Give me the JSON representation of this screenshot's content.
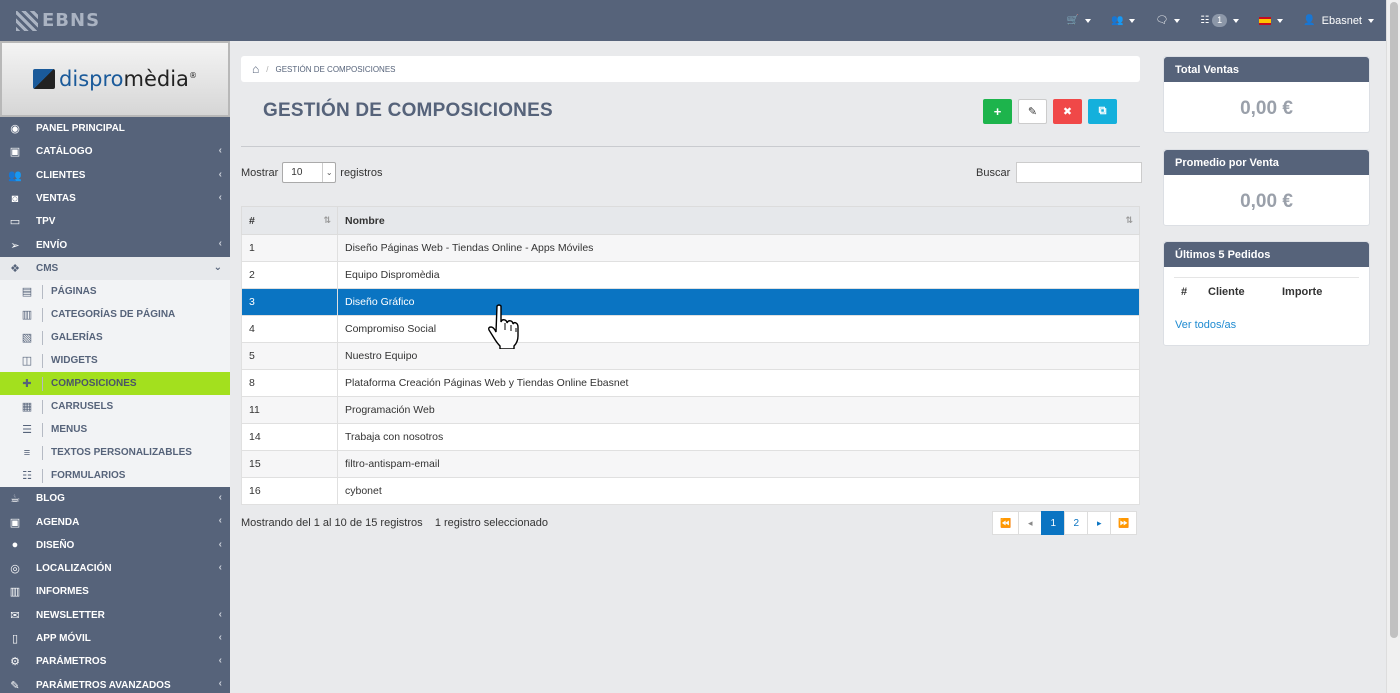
{
  "topbar": {
    "logo_text": "EBNS",
    "nav": [
      {
        "icon": "cart-icon",
        "glyph": "🛒"
      },
      {
        "icon": "users-icon",
        "glyph": "👥"
      },
      {
        "icon": "comments-icon",
        "glyph": "🗨"
      },
      {
        "icon": "list-icon",
        "glyph": "☷",
        "badge": "1"
      },
      {
        "icon": "flag-es-icon"
      },
      {
        "icon": "user-icon",
        "glyph": "👤",
        "label": "Ebasnet"
      }
    ]
  },
  "brand": {
    "name_a": "dispro",
    "name_b": "mèdia",
    "reg": "®"
  },
  "sidebar": {
    "items": [
      {
        "label": "PANEL PRINCIPAL",
        "icon": "dashboard-icon",
        "glyph": "◉",
        "arrow": ""
      },
      {
        "label": "CATÁLOGO",
        "icon": "box-icon",
        "glyph": "▣",
        "arrow": "‹"
      },
      {
        "label": "CLIENTES",
        "icon": "users-icon",
        "glyph": "👥",
        "arrow": "‹"
      },
      {
        "label": "VENTAS",
        "icon": "money-icon",
        "glyph": "◙",
        "arrow": "‹"
      },
      {
        "label": "TPV",
        "icon": "credit-card-icon",
        "glyph": "▭",
        "arrow": ""
      },
      {
        "label": "ENVÍO",
        "icon": "paper-plane-icon",
        "glyph": "➢",
        "arrow": "‹"
      },
      {
        "label": "CMS",
        "icon": "cubes-icon",
        "glyph": "❖",
        "arrow": "⌄"
      }
    ],
    "sub_items": [
      {
        "label": "PÁGINAS",
        "icon": "file-icon",
        "glyph": "▤"
      },
      {
        "label": "CATEGORÍAS DE PÁGINA",
        "icon": "files-icon",
        "glyph": "▥"
      },
      {
        "label": "GALERÍAS",
        "icon": "image-icon",
        "glyph": "▧"
      },
      {
        "label": "WIDGETS",
        "icon": "columns-icon",
        "glyph": "◫"
      },
      {
        "label": "COMPOSICIONES",
        "icon": "puzzle-icon",
        "glyph": "✚"
      },
      {
        "label": "CARRUSELS",
        "icon": "carousel-icon",
        "glyph": "▦"
      },
      {
        "label": "MENUS",
        "icon": "menu-icon",
        "glyph": "☰"
      },
      {
        "label": "TEXTOS PERSONALIZABLES",
        "icon": "align-left-icon",
        "glyph": "≡"
      },
      {
        "label": "FORMULARIOS",
        "icon": "form-list-icon",
        "glyph": "☷"
      }
    ],
    "items_after": [
      {
        "label": "BLOG",
        "icon": "coffee-icon",
        "glyph": "☕",
        "arrow": "‹"
      },
      {
        "label": "AGENDA",
        "icon": "calendar-icon",
        "glyph": "▣",
        "arrow": "‹"
      },
      {
        "label": "DISEÑO",
        "icon": "tint-icon",
        "glyph": "●",
        "arrow": "‹"
      },
      {
        "label": "LOCALIZACIÓN",
        "icon": "compass-icon",
        "glyph": "◎",
        "arrow": "‹"
      },
      {
        "label": "INFORMES",
        "icon": "bar-chart-icon",
        "glyph": "▥",
        "arrow": ""
      },
      {
        "label": "NEWSLETTER",
        "icon": "envelope-icon",
        "glyph": "✉",
        "arrow": "‹"
      },
      {
        "label": "APP MÓVIL",
        "icon": "mobile-icon",
        "glyph": "▯",
        "arrow": "‹"
      },
      {
        "label": "PARÁMETROS",
        "icon": "cogs-icon",
        "glyph": "⚙",
        "arrow": "‹"
      },
      {
        "label": "PARÁMETROS AVANZADOS",
        "icon": "wrench-icon",
        "glyph": "✎",
        "arrow": "‹"
      }
    ]
  },
  "breadcrumb": {
    "home_glyph": "⌂",
    "current": "GESTIÓN DE COMPOSICIONES"
  },
  "page_title": "GESTIÓN DE COMPOSICIONES",
  "actions": {
    "add": "+",
    "edit": "✎",
    "delete": "✖",
    "copy": "⧉"
  },
  "length_menu": {
    "prefix": "Mostrar",
    "value": "10",
    "suffix": "registros"
  },
  "search": {
    "label": "Buscar",
    "value": ""
  },
  "table": {
    "columns": [
      "#",
      "Nombre"
    ],
    "rows": [
      {
        "id": "1",
        "name": "Diseño Páginas Web - Tiendas Online - Apps Móviles"
      },
      {
        "id": "2",
        "name": "Equipo Dispromèdia"
      },
      {
        "id": "3",
        "name": "Diseño Gráfico",
        "selected": true
      },
      {
        "id": "4",
        "name": "Compromiso Social"
      },
      {
        "id": "5",
        "name": "Nuestro Equipo"
      },
      {
        "id": "8",
        "name": "Plataforma Creación Páginas Web y Tiendas Online Ebasnet"
      },
      {
        "id": "11",
        "name": "Programación Web"
      },
      {
        "id": "14",
        "name": "Trabaja con nosotros"
      },
      {
        "id": "15",
        "name": "filtro-antispam-email"
      },
      {
        "id": "16",
        "name": "cybonet"
      }
    ]
  },
  "info": {
    "showing": "Mostrando del 1 al 10 de 15 registros",
    "selected": "1 registro seleccionado"
  },
  "pagination": {
    "first": "⏪",
    "prev": "◂",
    "pages": [
      "1",
      "2"
    ],
    "current": "1",
    "next": "▸",
    "last": "⏩"
  },
  "panels": {
    "total_ventas": {
      "title": "Total Ventas",
      "value": "0,00 €"
    },
    "promedio": {
      "title": "Promedio por Venta",
      "value": "0,00 €"
    },
    "pedidos": {
      "title": "Últimos 5 Pedidos",
      "cols": [
        "#",
        "Cliente",
        "Importe"
      ],
      "link": "Ver todos/as"
    }
  },
  "colors": {
    "topbar": "#56637a",
    "accent": "#0a74c2",
    "active_menu": "#a3e01e",
    "add": "#1db44c",
    "delete": "#f04848",
    "copy": "#14b0dc"
  }
}
